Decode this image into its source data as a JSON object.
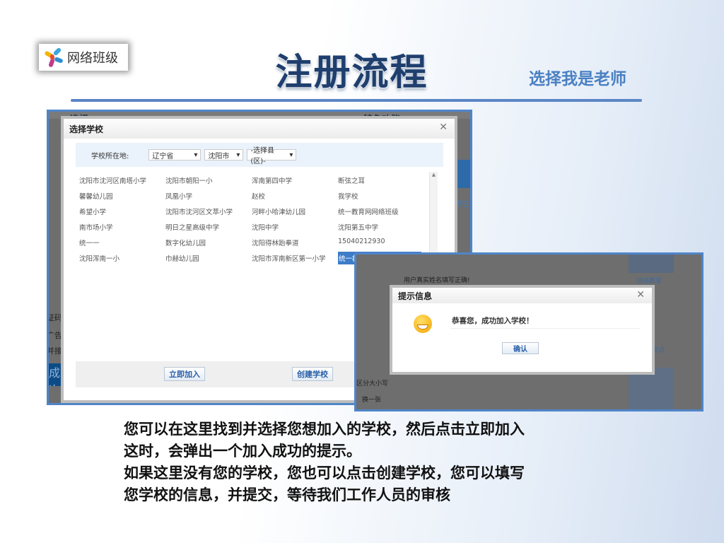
{
  "logo": {
    "text": "网络班级"
  },
  "header": {
    "title": "注册流程",
    "subtitle": "选择我是老师"
  },
  "select_school_dialog": {
    "title": "选择学校",
    "location_label": "学校所在地:",
    "province": "辽宁省",
    "city": "沈阳市",
    "district": "-选择县(区)-",
    "schools": [
      [
        "沈阳市沈河区南塔小学",
        "沈阳市朝阳一小",
        "浑南第四中学",
        "断弦之耳"
      ],
      [
        "馨馨幼儿园",
        "凤凰小学",
        "赵校",
        "我学校"
      ],
      [
        "希望小学",
        "沈阳市沈河区文萃小学",
        "河畔小哈津幼儿园",
        "统一教育网网络班级"
      ],
      [
        "南市场小学",
        "明日之星高级中学",
        "沈阳中学",
        "沈阳第五中学"
      ],
      [
        "统一一",
        "数字化幼儿园",
        "沈阳得林跆拳道",
        "15040212930"
      ],
      [
        "沈阳浑南一小",
        "巾赫幼儿园",
        "沈阳市浑南新区第一小学",
        "统一教"
      ]
    ],
    "join_button": "立即加入",
    "create_button": "创建学校",
    "background_text": [
      "证码",
      "广告",
      "并接",
      "成次",
      "选择",
      "特色功能",
      "学生"
    ]
  },
  "success_dialog": {
    "title": "提示信息",
    "message": "恭喜您，成功加入学校！",
    "confirm_button": "确认",
    "background_text": [
      "用户真实姓名填写正确!",
      "区分大小写",
      "换一张",
      "班级群发",
      "家访"
    ]
  },
  "instructions": [
    "您可以在这里找到并选择您想加入的学校，然后点击立即加入",
    "这时，会弹出一个加入成功的提示。",
    "如果这里没有您的学校，您也可以点击创建学校，您可以填写",
    "您学校的信息，并提交，等待我们工作人员的审核"
  ]
}
